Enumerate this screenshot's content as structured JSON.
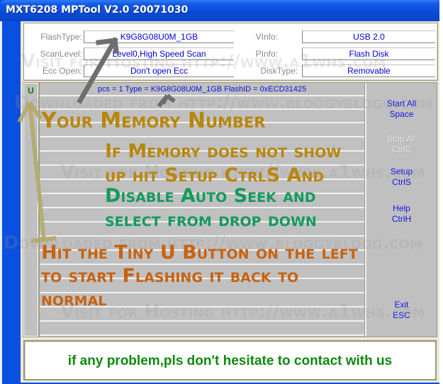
{
  "window": {
    "title": "MXT6208 MPTool V2.0 20071030"
  },
  "info": {
    "flash_type": {
      "label": "FlashType:",
      "value": "K9G8G08U0M_1GB"
    },
    "scan_level": {
      "label": "ScanLevel:",
      "value": "Level0,High Speed Scan"
    },
    "ecc_open": {
      "label": "Ecc Open:",
      "value": "Don't open Ecc"
    },
    "vinfo": {
      "label": "VInfo:",
      "value": "USB 2.0"
    },
    "pinfo": {
      "label": "PInfo:",
      "value": "Flash Disk"
    },
    "disk_type": {
      "label": "DiskType:",
      "value": "Removable"
    }
  },
  "port_list": {
    "u_button_label": "U",
    "first_row": "pcs = 1  Type = K9G8G08U0M_1GB  FlashID = 0xECD31425"
  },
  "side_buttons": [
    {
      "label": "Start All",
      "shortcut": "Space",
      "enabled": true
    },
    {
      "label": "Stop All",
      "shortcut": "CtrlC",
      "enabled": false
    },
    {
      "label": "Setup",
      "shortcut": "CtrlS",
      "enabled": true
    },
    {
      "label": "Help",
      "shortcut": "CtrlH",
      "enabled": true
    },
    {
      "label": "Exit",
      "shortcut": "ESC",
      "enabled": true
    }
  ],
  "status": {
    "message": "if any problem,pls don't hesitate to contact with us"
  },
  "annotations": {
    "memory_number": "Your Memory Number",
    "memory_help_lines": [
      "If Memory does not show",
      "up hit Setup CtrlS And"
    ],
    "disable_lines": [
      "Disable Auto Seek and",
      "select from drop down"
    ],
    "u_button_lines": [
      "Hit the Tiny U Button on the left",
      "to start Flashing it back to",
      "normal"
    ]
  },
  "watermarks": [
    "Visit for Hosting  http://www.a1whs.com",
    "Downloaded from  http://www.bloggyblogg.com",
    "Visit for Hosting  http://www.a1whs.com",
    "Downloaded from  http://www.bloggyblogg.com",
    "Visit for Hosting  http://www.a1whs.com"
  ],
  "colors": {
    "title_bar": "#0a4ad6",
    "value_text": "#0000d0",
    "u_button": "#008000",
    "status_text": "#0d8a0d",
    "annotation_gold": "#b8860b",
    "annotation_green": "#149a5e",
    "annotation_orange": "#c8620f"
  }
}
